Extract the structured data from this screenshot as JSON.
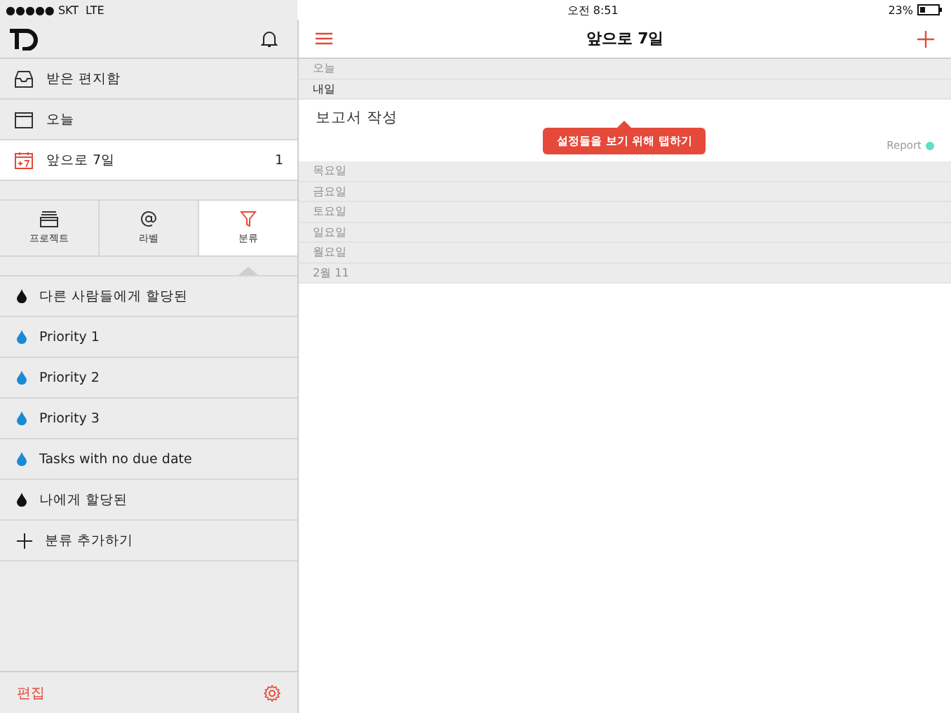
{
  "status_bar": {
    "carrier": "●●●●● SKT",
    "network": "LTE",
    "time": "오전 8:51",
    "battery": "23%"
  },
  "sidebar": {
    "nav_items": [
      {
        "kind": "inbox",
        "label": "받은 편지함",
        "selected": false
      },
      {
        "kind": "today",
        "label": "오늘",
        "selected": false
      },
      {
        "kind": "week",
        "label": "앞으로 7일",
        "count": "1",
        "selected": true
      }
    ],
    "tabs": [
      {
        "kind": "projects",
        "label": "프로젝트",
        "selected": false
      },
      {
        "kind": "labels",
        "label": "라벨",
        "selected": false
      },
      {
        "kind": "filters",
        "label": "분류",
        "selected": true
      }
    ],
    "filters": [
      {
        "kind": "drop",
        "label": "다른 사람들에게 할당된",
        "color": "#111111"
      },
      {
        "kind": "drop",
        "label": "Priority 1",
        "color": "#1a8ad4"
      },
      {
        "kind": "drop",
        "label": "Priority 2",
        "color": "#1a8ad4"
      },
      {
        "kind": "drop",
        "label": "Priority 3",
        "color": "#1a8ad4"
      },
      {
        "kind": "drop",
        "label": "Tasks with no due date",
        "color": "#1a8ad4"
      },
      {
        "kind": "drop",
        "label": "나에게 할당된",
        "color": "#111111"
      },
      {
        "kind": "add",
        "label": "분류 추가하기"
      }
    ],
    "footer": {
      "edit": "편집"
    }
  },
  "main": {
    "title": "앞으로 7일",
    "days": [
      {
        "label": "오늘",
        "dimmed": true
      },
      {
        "label": "내일",
        "dimmed": false,
        "tasks": [
          {
            "title": "보고서 작성",
            "project": "Report",
            "color": "#5fe0c8"
          }
        ]
      },
      {
        "label": "목요일",
        "dimmed": true
      },
      {
        "label": "금요일",
        "dimmed": true
      },
      {
        "label": "토요일",
        "dimmed": true
      },
      {
        "label": "일요일",
        "dimmed": true
      },
      {
        "label": "월요일",
        "dimmed": true
      },
      {
        "label": "2월 11",
        "dimmed": true
      }
    ],
    "tooltip": "설정들을 보기 위해 탭하기"
  }
}
